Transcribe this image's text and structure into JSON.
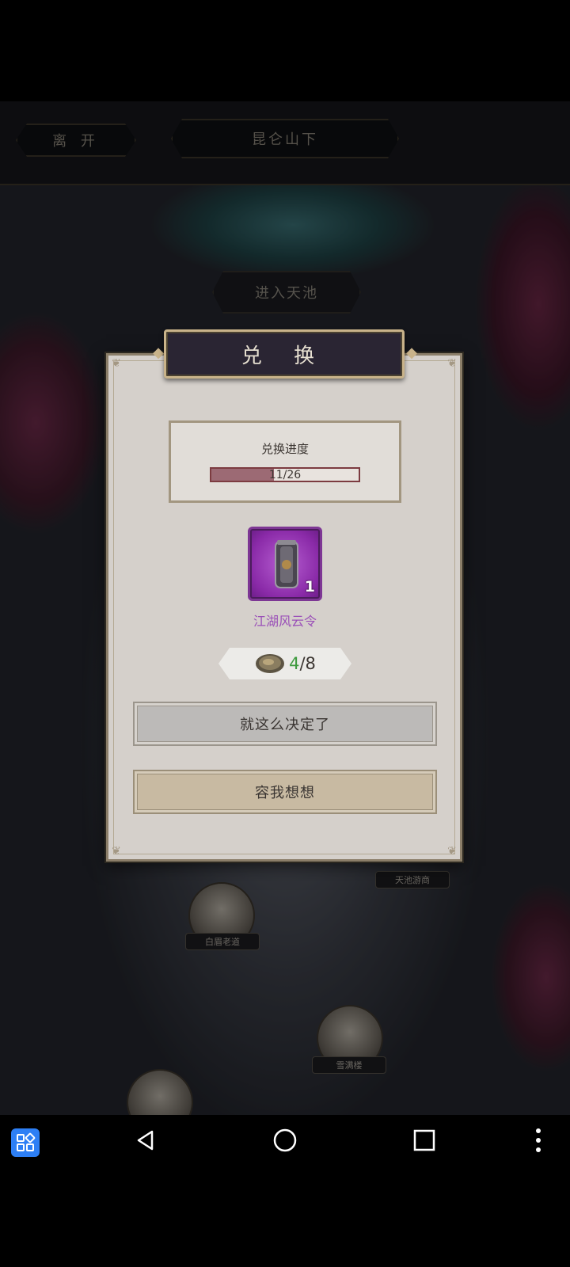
{
  "header": {
    "leave_label": "离 开",
    "location_label": "昆仑山下"
  },
  "map": {
    "enter_tianchi_label": "进入天池",
    "npcs": [
      {
        "label": "白眉老道"
      },
      {
        "label": "雪满楼"
      },
      {
        "label": "天池游商"
      }
    ]
  },
  "dialog": {
    "title": "兑 换",
    "progress_title": "兑换进度",
    "progress_text": "11/26",
    "progress_current": 11,
    "progress_total": 26,
    "item": {
      "name": "江湖风云令",
      "count": "1",
      "rarity_color": "#8a2aa8",
      "icon": "token-medallion-icon"
    },
    "cost": {
      "icon": "stone-coin-icon",
      "have": "4",
      "separator": "/",
      "need": "8",
      "have_color": "#3e9a3e"
    },
    "confirm_label": "就这么决定了",
    "cancel_label": "容我想想"
  },
  "navbar": {
    "icons": [
      "apps-icon",
      "back-icon",
      "home-icon",
      "recent-apps-icon",
      "more-icon"
    ]
  }
}
